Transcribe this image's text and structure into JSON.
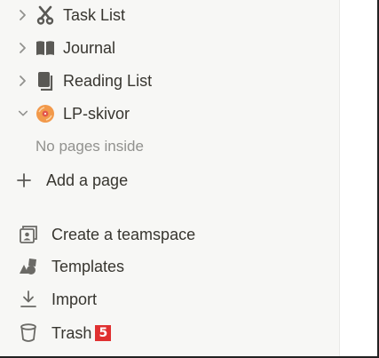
{
  "sidebar": {
    "pages": [
      {
        "label": "Task List",
        "icon": "scissors-icon",
        "expanded": false
      },
      {
        "label": "Journal",
        "icon": "book-open-icon",
        "expanded": false
      },
      {
        "label": "Reading List",
        "icon": "books-icon",
        "expanded": false
      },
      {
        "label": "LP-skivor",
        "icon": "vinyl-record-icon",
        "expanded": true
      }
    ],
    "empty_text": "No pages inside",
    "add_page_label": "Add a page",
    "bottom": {
      "create_teamspace_label": "Create a teamspace",
      "templates_label": "Templates",
      "import_label": "Import",
      "trash_label": "Trash",
      "trash_badge": "5"
    }
  },
  "colors": {
    "sidebar_bg": "#f7f7f5",
    "text": "#37352f",
    "muted": "#91918e",
    "badge": "#e03131",
    "record": "#f2994a"
  }
}
